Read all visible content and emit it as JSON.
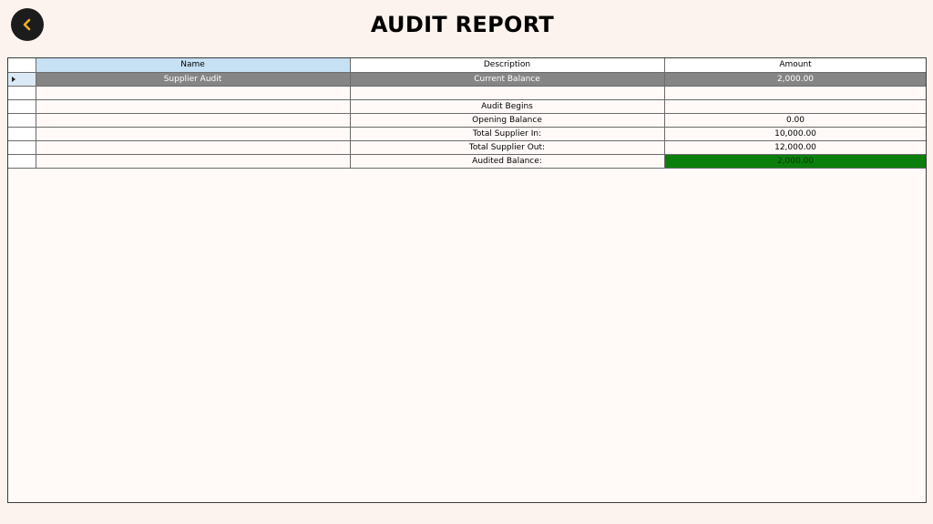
{
  "header": {
    "title": "AUDIT REPORT",
    "back_icon": "chevron-left-icon",
    "back_icon_color": "#f2b21b"
  },
  "grid": {
    "columns": [
      "Name",
      "Description",
      "Amount"
    ],
    "rows": [
      {
        "name": "Supplier Audit",
        "description": "Current Balance",
        "amount": "2,000.00"
      },
      {
        "name": "",
        "description": "",
        "amount": ""
      },
      {
        "name": "",
        "description": "Audit Begins",
        "amount": ""
      },
      {
        "name": "",
        "description": "Opening Balance",
        "amount": "0.00"
      },
      {
        "name": "",
        "description": "Total Supplier In:",
        "amount": "10,000.00"
      },
      {
        "name": "",
        "description": "Total Supplier Out:",
        "amount": "12,000.00"
      },
      {
        "name": "",
        "description": "Audited Balance:",
        "amount": "2,000.00"
      }
    ],
    "selected_row": 0,
    "colors": {
      "selected_row_bg": "#858585",
      "header_name_bg": "#c6e0f4",
      "audited_balance_bg": "#0b7f0b",
      "page_bg": "#fdf3ee"
    }
  }
}
